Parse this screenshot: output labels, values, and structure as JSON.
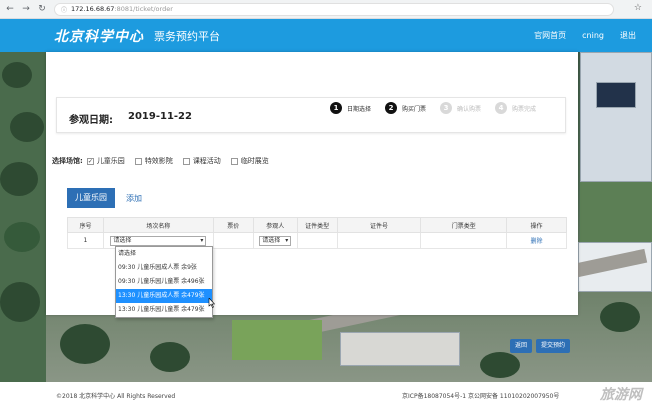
{
  "browser": {
    "url_host": "172.16.68.67",
    "url_rest": ":8081/ticket/order"
  },
  "header": {
    "logo": "北京科学中心",
    "title": "票务预约平台",
    "nav": [
      "官网首页",
      "cning",
      "退出"
    ]
  },
  "visit": {
    "label": "参观日期:",
    "date": "2019-11-22"
  },
  "steps": [
    {
      "num": "1",
      "label": "日期选择",
      "active": true
    },
    {
      "num": "2",
      "label": "购买门票",
      "active": true
    },
    {
      "num": "3",
      "label": "确认购票",
      "active": false
    },
    {
      "num": "4",
      "label": "购票完成",
      "active": false
    }
  ],
  "venue": {
    "title": "选择场馆:",
    "options": [
      {
        "label": "儿童乐园",
        "checked": true
      },
      {
        "label": "特效影院",
        "checked": false
      },
      {
        "label": "课程活动",
        "checked": false
      },
      {
        "label": "临时展览",
        "checked": false
      }
    ]
  },
  "tabs": {
    "active": "儿童乐园",
    "add": "添加"
  },
  "table": {
    "headers": [
      "序号",
      "场次名称",
      "票价",
      "参观人",
      "证件类型",
      "证件号",
      "门票类型",
      "操作"
    ],
    "row": {
      "index": "1",
      "session_select": "请选择",
      "visitor_select": "请选择",
      "action": "删除"
    }
  },
  "dropdown": {
    "options": [
      "请选择",
      "09:30 儿童乐园成人票 余9张",
      "09:30 儿童乐园儿童票 余496张",
      "13:30 儿童乐园成人票 余479张",
      "13:30 儿童乐园儿童票 余479张"
    ],
    "highlighted_index": 3
  },
  "buttons": {
    "back": "返回",
    "submit": "提交预约"
  },
  "footer": {
    "copyright": "©2018 北京科学中心 All Rights Reserved",
    "icp": "京ICP备18087054号-1    京公网安备 11010202007950号"
  },
  "watermark": "旅游网"
}
